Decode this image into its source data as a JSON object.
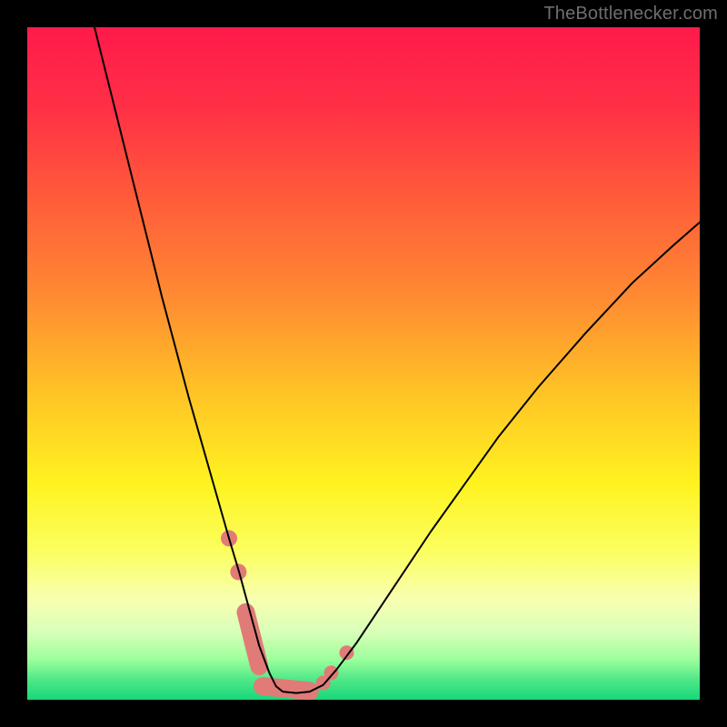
{
  "watermark": {
    "text": "TheBottlenecker.com"
  },
  "chart_data": {
    "type": "line",
    "title": "",
    "xlabel": "",
    "ylabel": "",
    "xlim": [
      0,
      100
    ],
    "ylim": [
      0,
      100
    ],
    "background_gradient": {
      "stops": [
        {
          "offset": 0.0,
          "color": "#ff1a4b"
        },
        {
          "offset": 0.12,
          "color": "#ff3046"
        },
        {
          "offset": 0.25,
          "color": "#ff5a3a"
        },
        {
          "offset": 0.4,
          "color": "#ff8a32"
        },
        {
          "offset": 0.54,
          "color": "#ffc226"
        },
        {
          "offset": 0.68,
          "color": "#fff320"
        },
        {
          "offset": 0.78,
          "color": "#fbff60"
        },
        {
          "offset": 0.85,
          "color": "#f8ffb0"
        },
        {
          "offset": 0.9,
          "color": "#d8ffb8"
        },
        {
          "offset": 0.94,
          "color": "#9cff9c"
        },
        {
          "offset": 0.97,
          "color": "#4fe887"
        },
        {
          "offset": 1.0,
          "color": "#17d77a"
        }
      ]
    },
    "series": [
      {
        "name": "curve",
        "stroke": "#000000",
        "stroke_width": 2,
        "x": [
          10.0,
          12.0,
          14.0,
          16.0,
          18.0,
          20.0,
          22.0,
          24.0,
          26.0,
          28.0,
          30.0,
          31.5,
          33.0,
          34.5,
          36.0,
          37.0,
          38.0,
          40.0,
          42.0,
          44.0,
          46.0,
          49.0,
          52.0,
          56.0,
          60.0,
          65.0,
          70.0,
          76.0,
          83.0,
          90.0,
          96.0,
          100.0
        ],
        "y": [
          100.0,
          92.0,
          84.0,
          76.0,
          68.0,
          60.0,
          52.5,
          45.0,
          38.0,
          31.0,
          24.0,
          19.0,
          13.5,
          8.0,
          4.0,
          2.0,
          1.2,
          1.0,
          1.2,
          2.2,
          4.5,
          8.5,
          13.0,
          19.0,
          25.0,
          32.0,
          39.0,
          46.5,
          54.5,
          62.0,
          67.5,
          71.0
        ]
      }
    ],
    "scatter": {
      "name": "markers",
      "fill": "#e07b78",
      "stroke": "#e07b78",
      "points_round": [
        {
          "x": 30.0,
          "y": 24.0,
          "r": 9
        },
        {
          "x": 31.4,
          "y": 19.0,
          "r": 9
        },
        {
          "x": 44.0,
          "y": 2.5,
          "r": 8
        },
        {
          "x": 45.2,
          "y": 4.0,
          "r": 8
        },
        {
          "x": 47.5,
          "y": 7.0,
          "r": 8
        }
      ],
      "points_pill": [
        {
          "x0": 32.5,
          "y0": 13.0,
          "x1": 34.5,
          "y1": 5.0,
          "r": 10
        },
        {
          "x0": 35.0,
          "y0": 2.0,
          "x1": 42.0,
          "y1": 1.3,
          "r": 10
        }
      ]
    }
  }
}
